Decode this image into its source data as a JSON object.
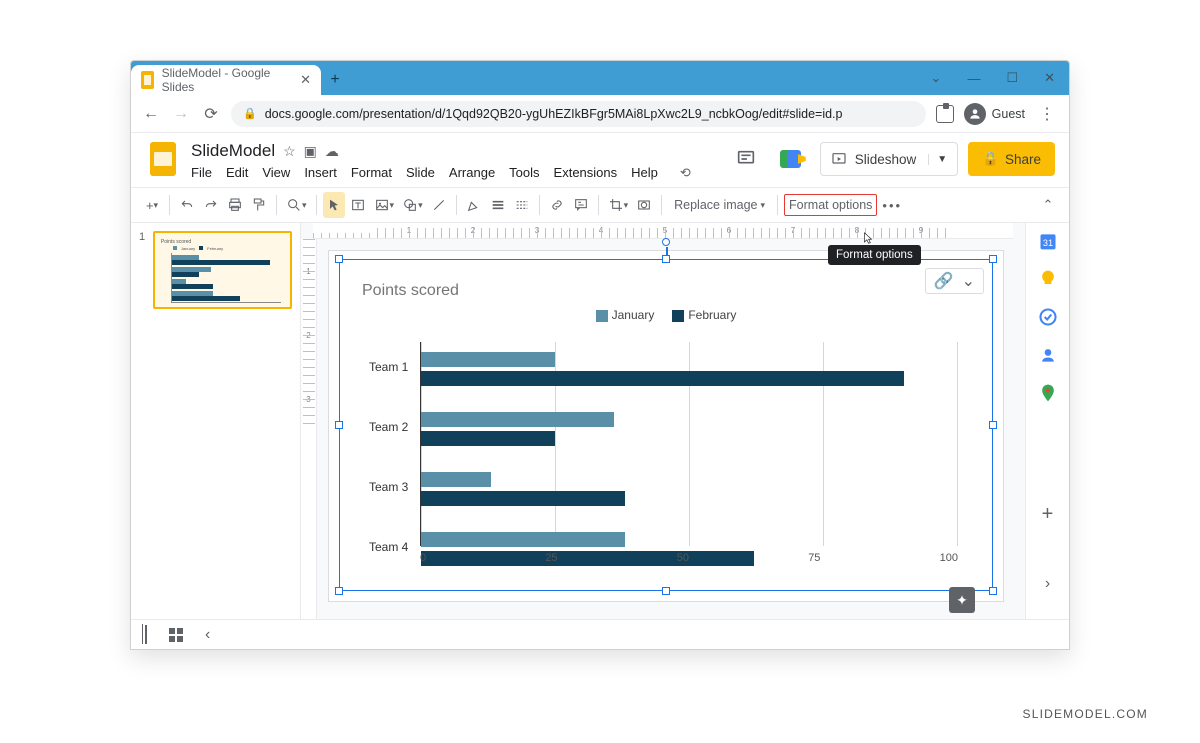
{
  "browser": {
    "tab_title": "SlideModel - Google Slides",
    "url": "docs.google.com/presentation/d/1Qqd92QB20-ygUhEZIkBFgr5MAi8LpXwc2L9_ncbkOog/edit#slide=id.p",
    "guest_label": "Guest"
  },
  "doc": {
    "title": "SlideModel",
    "menus": [
      "File",
      "Edit",
      "View",
      "Insert",
      "Format",
      "Slide",
      "Arrange",
      "Tools",
      "Extensions",
      "Help"
    ],
    "slideshow_label": "Slideshow",
    "share_label": "Share"
  },
  "toolbar": {
    "replace_image": "Replace image",
    "format_options": "Format options",
    "tooltip": "Format options"
  },
  "thumbnail": {
    "index": "1"
  },
  "chart_data": {
    "type": "bar",
    "orientation": "horizontal",
    "title": "Points scored",
    "categories": [
      "Team 1",
      "Team 2",
      "Team 3",
      "Team 4"
    ],
    "series": [
      {
        "name": "January",
        "color": "#5a8fa8",
        "values": [
          25,
          36,
          13,
          38
        ]
      },
      {
        "name": "February",
        "color": "#10405a",
        "values": [
          90,
          25,
          38,
          62
        ]
      }
    ],
    "xlabel": "",
    "ylabel": "",
    "xlim": [
      0,
      100
    ],
    "x_ticks": [
      0,
      25,
      50,
      75,
      100
    ]
  },
  "ruler": {
    "h": [
      "",
      "1",
      "2",
      "3",
      "4",
      "5",
      "6",
      "7",
      "8",
      "9"
    ],
    "v": [
      "1",
      "2",
      "3"
    ]
  },
  "watermark": "SLIDEMODEL.COM"
}
